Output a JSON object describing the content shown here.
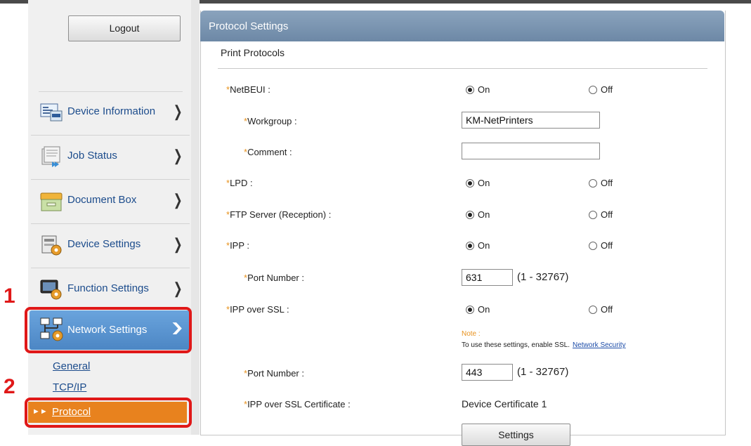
{
  "sidebar": {
    "logout_label": "Logout",
    "menu": [
      {
        "label": "Device Information",
        "icon": "device-information-icon"
      },
      {
        "label": "Job Status",
        "icon": "job-status-icon"
      },
      {
        "label": "Document Box",
        "icon": "document-box-icon"
      },
      {
        "label": "Device Settings",
        "icon": "device-settings-icon"
      },
      {
        "label": "Function Settings",
        "icon": "function-settings-icon"
      }
    ],
    "active_menu": {
      "label": "Network Settings",
      "icon": "network-settings-icon"
    },
    "sub_items": [
      "General",
      "TCP/IP"
    ],
    "active_sub": "Protocol",
    "callouts": [
      "1",
      "2"
    ]
  },
  "panel": {
    "title": "Protocol Settings",
    "section": "Print Protocols",
    "on_label": "On",
    "off_label": "Off",
    "rows": {
      "netbeui": "NetBEUI :",
      "workgroup": "Workgroup :",
      "workgroup_value": "KM-NetPrinters",
      "comment": "Comment :",
      "comment_value": "",
      "lpd": "LPD :",
      "ftp": "FTP Server (Reception) :",
      "ipp": "IPP :",
      "ipp_port": "Port Number :",
      "ipp_port_value": "631",
      "ipp_port_range": "(1 - 32767)",
      "ipp_ssl": "IPP over SSL :",
      "note_title": "Note :",
      "note_text": "To use these settings, enable SSL.",
      "note_link": "Network Security",
      "ssl_port": "Port Number :",
      "ssl_port_value": "443",
      "ssl_port_range": "(1 - 32767)",
      "ssl_cert": "IPP over SSL Certificate :",
      "ssl_cert_value": "Device Certificate 1",
      "settings_button": "Settings"
    }
  },
  "colors": {
    "accent_blue": "#4c86c4",
    "header_slate": "#6d88a6",
    "orange": "#e8821e",
    "callout_red": "#e01818"
  }
}
